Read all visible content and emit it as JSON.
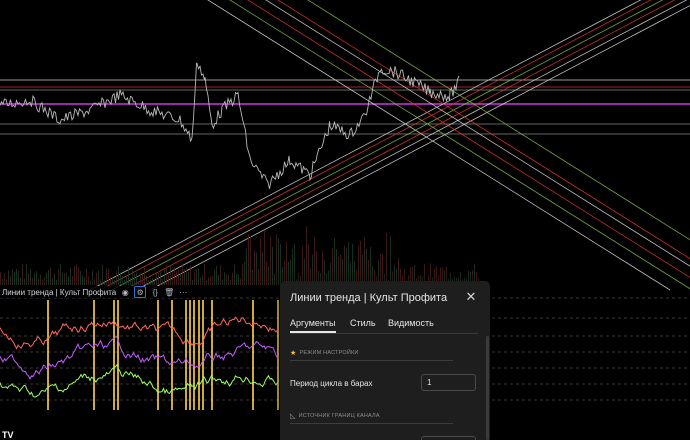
{
  "study": {
    "label": "Линии тренда | Культ Профита",
    "icons": [
      "eye-icon",
      "settings-icon",
      "source-code-icon",
      "trash-icon",
      "more-icon"
    ]
  },
  "corner_logo": "TV",
  "dialog": {
    "title": "Линии тренда | Культ Профита",
    "close_icon": "close-icon",
    "tabs": [
      {
        "label": "Аргументы",
        "active": true
      },
      {
        "label": "Стиль",
        "active": false
      },
      {
        "label": "Видимость",
        "active": false
      }
    ],
    "sections": [
      {
        "icon": "star-icon",
        "title": "РЕЖИМ НАСТРОЙКИ"
      },
      {
        "icon": "ruler-icon",
        "title": "ИСТОЧНИК ГРАНИЦ КАНАЛА"
      }
    ],
    "fields": [
      {
        "label": "Период цикла в барах",
        "value": "1"
      }
    ]
  },
  "colors": {
    "background": "#000000",
    "price": "#b8b8b8",
    "magenta_level": "#e040fb",
    "green_line": "#8bc34a",
    "red_line": "#e53935",
    "white_line": "#e0e0e0",
    "osc_red": "#ff6b5e",
    "osc_purple": "#c45cff",
    "osc_green": "#9cff6b",
    "osc_yellow_bar": "#ffd54f",
    "dialog_bg": "#1e1e1e"
  }
}
